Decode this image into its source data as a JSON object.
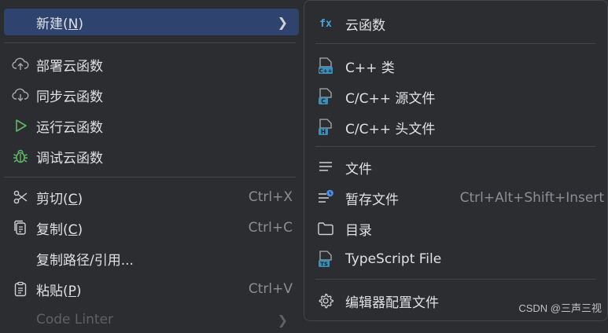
{
  "left_menu": {
    "new": {
      "label": "新建(",
      "mnemonic": "N",
      "suffix": ")"
    },
    "deploy": "部署云函数",
    "sync": "同步云函数",
    "run": "运行云函数",
    "debug": "调试云函数",
    "cut": {
      "label": "剪切(",
      "mnemonic": "C",
      "suffix": ")",
      "shortcut": "Ctrl+X"
    },
    "copy": {
      "label": "复制(",
      "mnemonic": "C",
      "suffix": ")",
      "shortcut": "Ctrl+C"
    },
    "copy_path": "复制路径/引用...",
    "paste": {
      "label": "粘贴(",
      "mnemonic": "P",
      "suffix": ")",
      "shortcut": "Ctrl+V"
    },
    "code_linter": "Code Linter"
  },
  "submenu": {
    "cloud_function": "云函数",
    "cpp_class": "C++ 类",
    "cpp_source": "C/C++ 源文件",
    "cpp_header": "C/C++ 头文件",
    "file": "文件",
    "scratch_file": "暂存文件",
    "scratch_shortcut": "Ctrl+Alt+Shift+Insert",
    "directory": "目录",
    "typescript_file": "TypeScript File",
    "editor_config": "编辑器配置文件"
  },
  "icons": {
    "fx": "fx",
    "cpp_badge": "C++",
    "c_badge": "C",
    "h_badge": "H",
    "ts_badge": "TS"
  },
  "watermark": "CSDN @三声三视",
  "colors": {
    "background": "#2b2d30",
    "selected": "#2e436e",
    "text": "#dfe1e5",
    "shortcut": "#8b8e94",
    "accent_blue": "#4aa3df",
    "run_green": "#5fb865"
  }
}
